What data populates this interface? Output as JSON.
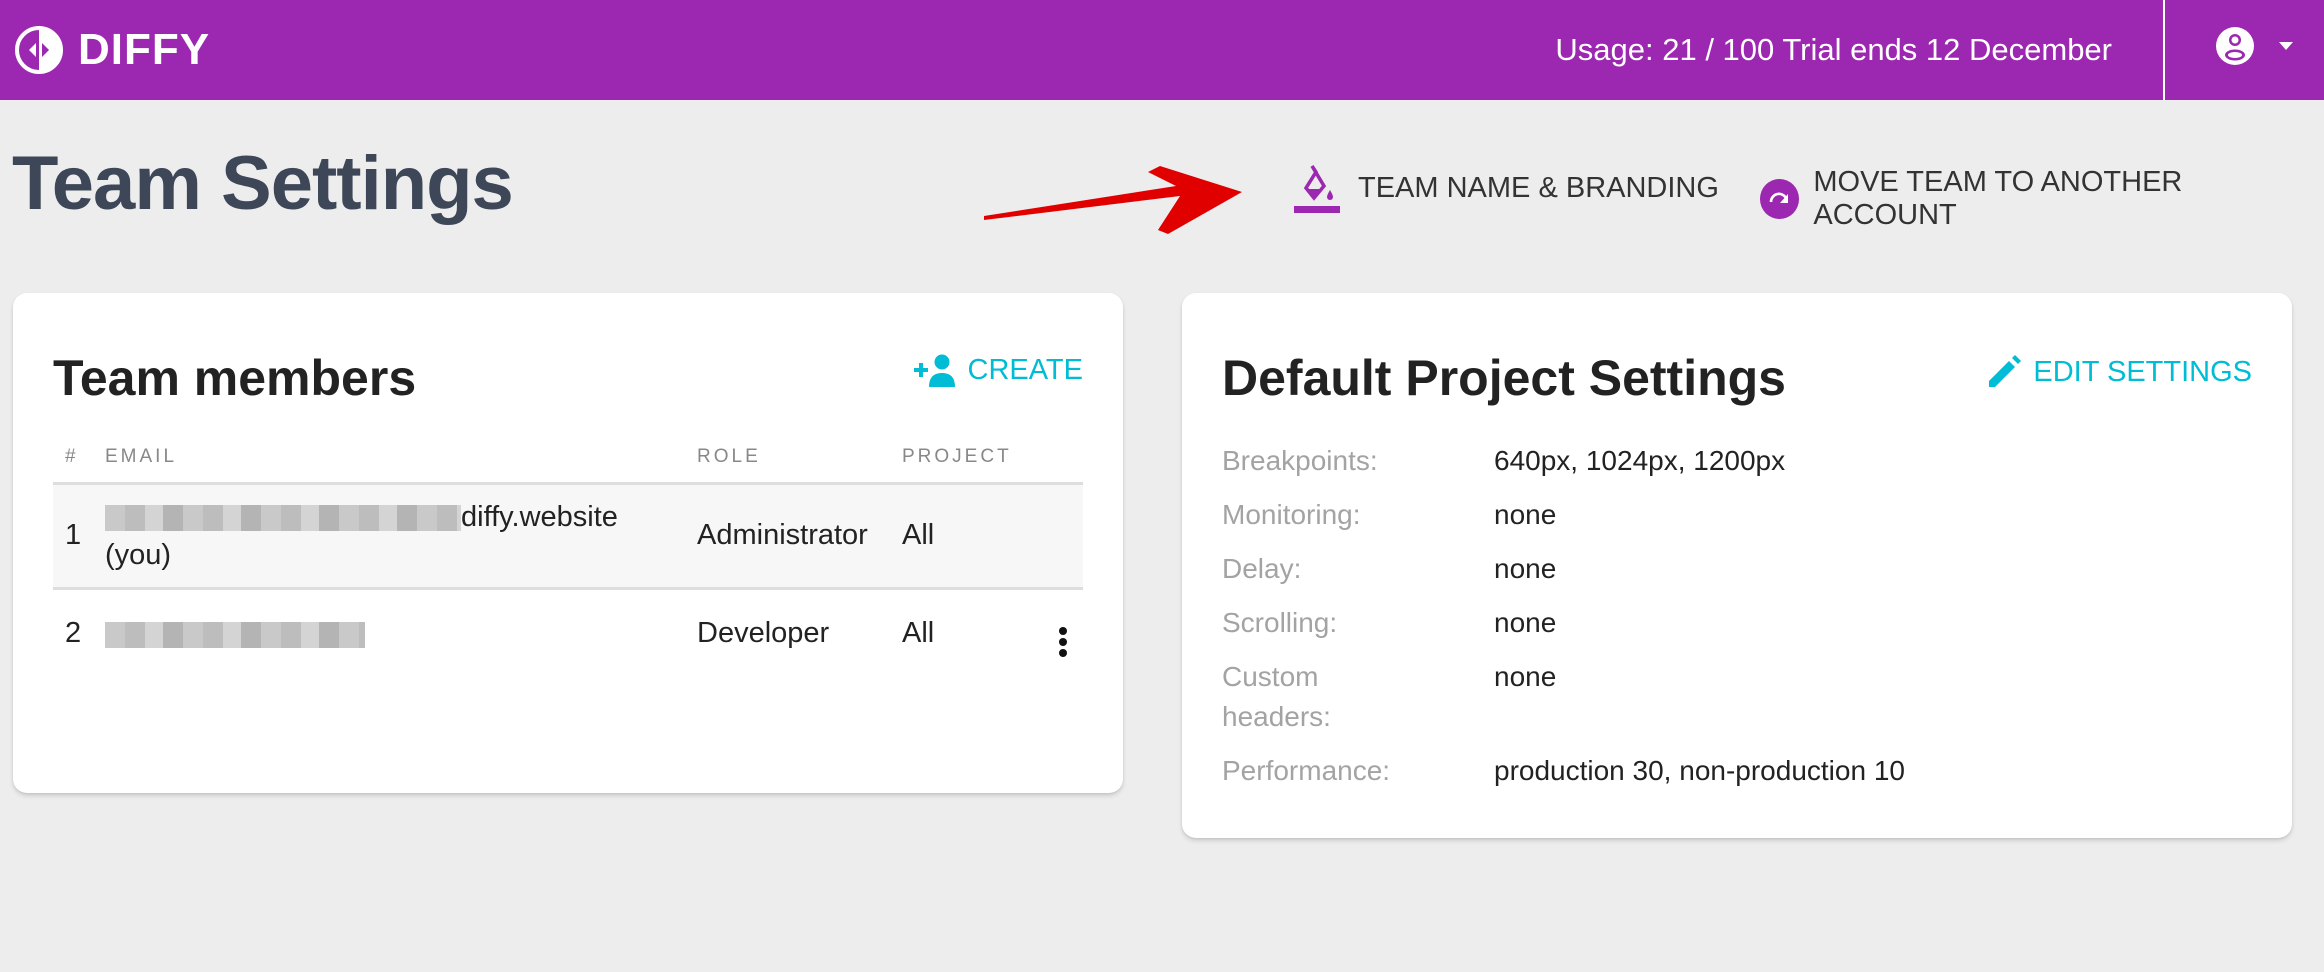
{
  "app": {
    "brand": "DIFFY",
    "accent_color": "#9c27b0",
    "link_color": "#00bcd4"
  },
  "topbar": {
    "usage_text": "Usage: 21 / 100 Trial ends 12 December",
    "account_icon": "account-circle-icon",
    "dropdown_icon": "caret-down-icon"
  },
  "page": {
    "title": "Team Settings",
    "actions": [
      {
        "label": "TEAM NAME & BRANDING",
        "icon": "paint-bucket-icon"
      },
      {
        "label": "MOVE TEAM TO ANOTHER ACCOUNT",
        "icon": "redo-circle-icon"
      }
    ]
  },
  "members_card": {
    "title": "Team members",
    "create_label": "CREATE",
    "create_icon": "add-person-icon",
    "columns": [
      "#",
      "EMAIL",
      "ROLE",
      "PROJECT"
    ],
    "rows": [
      {
        "num": "1",
        "email_suffix": "diffy.website",
        "you_label": "(you)",
        "role": "Administrator",
        "project": "All"
      },
      {
        "num": "2",
        "email_suffix": "",
        "role": "Developer",
        "project": "All"
      }
    ]
  },
  "defaults_card": {
    "title": "Default Project Settings",
    "edit_label": "EDIT SETTINGS",
    "edit_icon": "pencil-icon",
    "settings": [
      {
        "label": "Breakpoints:",
        "value": "640px, 1024px, 1200px"
      },
      {
        "label": "Monitoring:",
        "value": "none"
      },
      {
        "label": "Delay:",
        "value": "none"
      },
      {
        "label": "Scrolling:",
        "value": "none"
      },
      {
        "label": "Custom headers:",
        "value": "none"
      },
      {
        "label": "Performance:",
        "value": "production 30, non-production 10"
      }
    ]
  }
}
